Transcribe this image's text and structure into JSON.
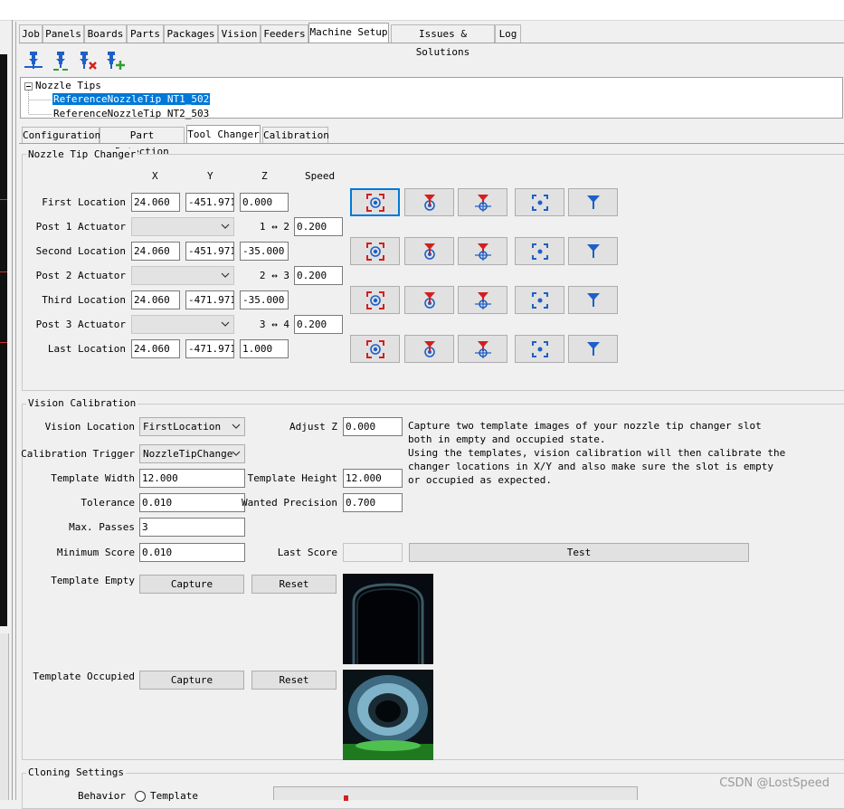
{
  "main_tabs": [
    "Job",
    "Panels",
    "Boards",
    "Parts",
    "Packages",
    "Vision",
    "Feeders",
    "Machine Setup",
    "Issues & Solutions",
    "Log"
  ],
  "main_tab_selected": "Machine Setup",
  "toolbar_icons": [
    "add-nozzle-tip-icon",
    "add-nozzle-tip-alt-icon",
    "delete-nozzle-tip-icon",
    "copy-nozzle-tip-icon"
  ],
  "tree": {
    "root": "Nozzle Tips",
    "items": [
      "ReferenceNozzleTip NT1_502",
      "ReferenceNozzleTip NT2_503"
    ],
    "selected_index": 0
  },
  "sub_tabs": [
    "Configuration",
    "Part Detection",
    "Tool Changer",
    "Calibration"
  ],
  "sub_tab_selected": "Tool Changer",
  "changer": {
    "title": "Nozzle Tip Changer",
    "headers": {
      "x": "X",
      "y": "Y",
      "z": "Z",
      "speed": "Speed"
    },
    "locations": [
      {
        "label": "First Location",
        "x": "24.060",
        "y": "-451.971",
        "z": "0.000"
      },
      {
        "label": "Second Location",
        "x": "24.060",
        "y": "-451.971",
        "z": "-35.000"
      },
      {
        "label": "Third Location",
        "x": "24.060",
        "y": "-471.971",
        "z": "-35.000"
      },
      {
        "label": "Last Location",
        "x": "24.060",
        "y": "-471.971",
        "z": "1.000"
      }
    ],
    "posts": [
      {
        "label": "Post 1 Actuator",
        "actuator": "",
        "transition": "1 ↔ 2",
        "speed": "0.200"
      },
      {
        "label": "Post 2 Actuator",
        "actuator": "",
        "transition": "2 ↔ 3",
        "speed": "0.200"
      },
      {
        "label": "Post 3 Actuator",
        "actuator": "",
        "transition": "3 ↔ 4",
        "speed": "0.200"
      }
    ],
    "button_icons": [
      "capture-camera-location-icon",
      "capture-nozzle-location-icon",
      "move-nozzle-to-location-icon",
      "position-camera-icon",
      "position-nozzle-icon"
    ]
  },
  "vision": {
    "title": "Vision Calibration",
    "vision_location_label": "Vision Location",
    "vision_location_value": "FirstLocation",
    "adjust_z_label": "Adjust Z",
    "adjust_z_value": "0.000",
    "calibration_trigger_label": "Calibration Trigger",
    "calibration_trigger_value": "NozzleTipChange",
    "template_width_label": "Template Width",
    "template_width_value": "12.000",
    "template_height_label": "Template Height",
    "template_height_value": "12.000",
    "tolerance_label": "Tolerance",
    "tolerance_value": "0.010",
    "wanted_precision_label": "Wanted Precision",
    "wanted_precision_value": "0.700",
    "max_passes_label": "Max. Passes",
    "max_passes_value": "3",
    "minimum_score_label": "Minimum Score",
    "minimum_score_value": "0.010",
    "last_score_label": "Last Score",
    "last_score_value": "",
    "test_label": "Test",
    "description": "Capture two template images of your nozzle tip changer slot\nboth in empty and occupied state.\nUsing the templates, vision calibration will then calibrate the\nchanger locations in X/Y and also make sure the slot is empty\nor occupied as expected.",
    "template_empty_label": "Template Empty",
    "template_occupied_label": "Template Occupied",
    "capture_label": "Capture",
    "reset_label": "Reset"
  },
  "cloning": {
    "title": "Cloning Settings",
    "behavior_label": "Behavior",
    "behavior_option": "Template"
  },
  "watermark": "CSDN @LostSpeed",
  "colors": {
    "selection": "#0078d7",
    "nozzle_blue": "#1e5fc8",
    "nozzle_red": "#d21f1f",
    "focus": "#0078d7"
  }
}
